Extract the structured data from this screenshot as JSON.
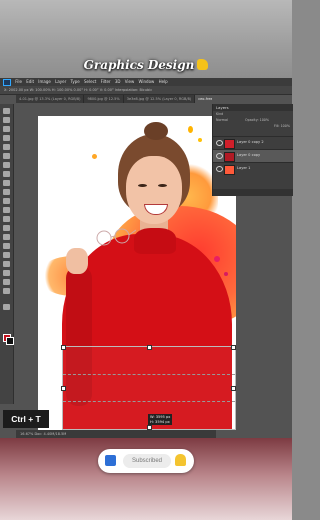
{
  "brand": {
    "title": "Graphics Design"
  },
  "photoshop": {
    "menu": [
      "File",
      "Edit",
      "Image",
      "Layer",
      "Type",
      "Select",
      "Filter",
      "3D",
      "View",
      "Window",
      "Help"
    ],
    "options_bar": "X: 2002.00 px   W: 100.00%   H: 100.00%   0.00°   H: 0.00°   V: 0.00°   Interpolation: Bicubic",
    "tabs": [
      "4-01.jpg @ 13.3% (Layer 0, RGB/8)",
      "9800.jpg @ 12.5%",
      "3e3e8.jpg @ 12.5% (Layer 0, RGB/8)",
      "ceo-free.jpg @ 16.7% (Layer 1, RGB/8)"
    ],
    "active_tab_index": 3,
    "status": "16.67%   Doc: 4.40M/18.5M",
    "layers_panel": {
      "title": "Layers",
      "kind_row": "Kind",
      "blend_mode": "Normal",
      "opacity": "Opacity: 100%",
      "fill": "Fill: 100%",
      "layers": [
        {
          "name": "Layer 0 copy 2",
          "selected": false,
          "thumb": "#cf1f2a"
        },
        {
          "name": "Layer 0 copy",
          "selected": true,
          "thumb": "#b01a25"
        },
        {
          "name": "Layer 1",
          "selected": false,
          "thumb": "#ff5a3a"
        }
      ]
    },
    "transform_readout": {
      "w": "W: 3595 px",
      "h": "H: 3594 px"
    },
    "colors": {
      "foreground": "#c1121f",
      "background": "#111111",
      "accent": "#31a8ff"
    }
  },
  "overlay": {
    "shortcut": "Ctrl + T"
  },
  "subscribe": {
    "label": "Subscribed",
    "like_icon": "thumbs-up-icon",
    "bell_icon": "bell-icon"
  }
}
